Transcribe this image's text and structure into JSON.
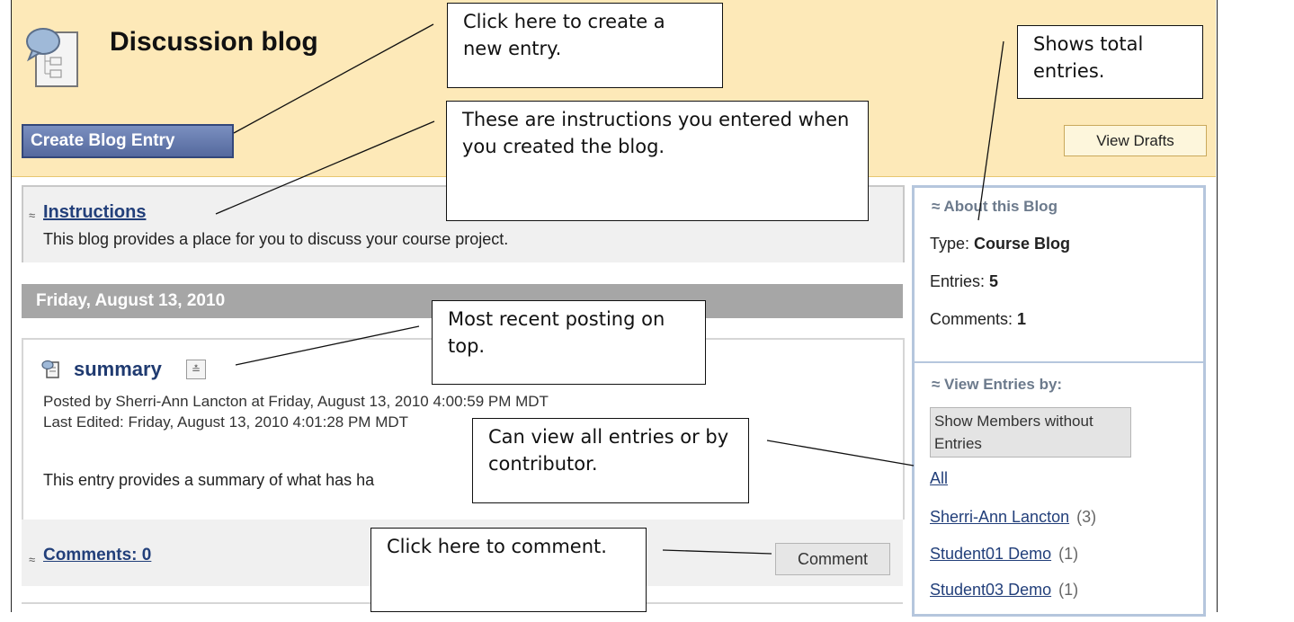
{
  "header": {
    "title": "Discussion blog",
    "create_button": "Create Blog Entry",
    "drafts_button": "View Drafts"
  },
  "instructions": {
    "toggle": "≈",
    "link": "Instructions",
    "text": "This blog provides a place for you to discuss your course project."
  },
  "date_header": "Friday, August 13, 2010",
  "entry": {
    "title": "summary",
    "menu_icon": "chevron-down-icon",
    "posted": "Posted by  Sherri-Ann Lancton at  Friday, August 13, 2010 4:00:59 PM MDT",
    "edited": "Last Edited: Friday, August 13, 2010 4:01:28 PM MDT",
    "body": "This entry provides a summary of what has ha"
  },
  "comments": {
    "toggle": "≈",
    "link": "Comments: 0",
    "button": "Comment"
  },
  "sidebar": {
    "about_heading": "≈ About this Blog",
    "type_label": "Type: ",
    "type_value": "Course Blog",
    "entries_label": "Entries: ",
    "entries_value": "5",
    "comments_label": "Comments: ",
    "comments_value": "1",
    "view_heading": "≈ View Entries by:",
    "members_button": "Show Members without Entries",
    "all_link": "All",
    "members": [
      {
        "name": "Sherri-Ann Lancton",
        "count": "(3)"
      },
      {
        "name": "Student01 Demo",
        "count": "(1)"
      },
      {
        "name": "Student03 Demo",
        "count": "(1)"
      }
    ]
  },
  "callouts": {
    "create": "Click here to create a new entry.",
    "total": "Shows total entries.",
    "instructions": "These are instructions you entered when you created the blog.",
    "recent": "Most recent posting on top.",
    "view_by": "Can view all entries or by contributor.",
    "comment": "Click here to comment."
  }
}
